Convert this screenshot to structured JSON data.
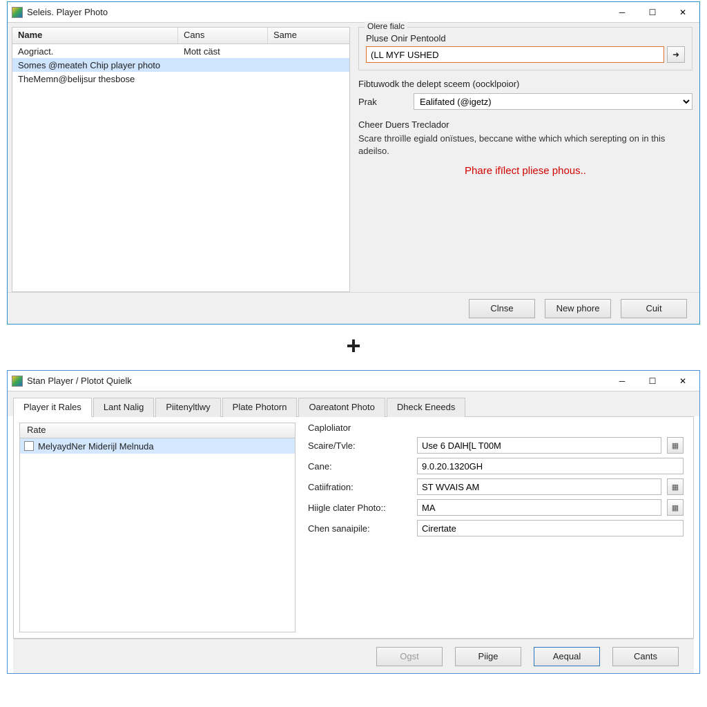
{
  "window1": {
    "title": "Seleis. Player Photo",
    "columns": {
      "c0": "Name",
      "c1": "Cans",
      "c2": "Same"
    },
    "rows": [
      {
        "name": "Aogriact.",
        "cans": "Mott cäst",
        "same": ""
      },
      {
        "name": "Somes @meateh Chip player photo",
        "cans": "",
        "same": ""
      },
      {
        "name": "TheMemn@belijsur thesbose",
        "cans": "",
        "same": ""
      }
    ],
    "selectedRow": 1,
    "group_legend": "Olere fialc",
    "field1_label": "Pluse Onir Pentoold",
    "field1_value": "(LL MYF USHED",
    "section2_title": "Fibtuwodk the delept sceem (oocklpoior)",
    "prak_label": "Prak",
    "prak_value": "Ealifated (@igetz)",
    "section3_title": "Cheer Duers Treclador",
    "desc": "Scare throïlle egiald onïstues, beccane withe which which serepting on in this adeilso.",
    "warn": "Phare ifïlect pliese phous..",
    "buttons": {
      "close": "Clnse",
      "new": "New phore",
      "cuit": "Cuit"
    }
  },
  "plus": "+",
  "window2": {
    "title": "Stan Player / Plotot Quielk",
    "tabs": [
      "Player it Rales",
      "Lant Nalig",
      "Piitenyltlwy",
      "Plate Photorn",
      "Oareatont Photo",
      "Dheck Eneeds"
    ],
    "activeTab": 0,
    "rate_header": "Rate",
    "rate_item": "MelyaydNer Miderijl Melnuda",
    "cap_legend": "Caploliator",
    "fields": {
      "scare_label": "Scaire/Tvle:",
      "scare_value": "Use 6 DAlH[L T00M",
      "cane_label": "Cane:",
      "cane_value": "9.0.20.1320GH",
      "cat_label": "Catiifration:",
      "cat_value": "ST WVAIS AM",
      "hig_label": "Hiigle clater Photo::",
      "hig_value": "MA",
      "chen_label": "Chen sanaipile:",
      "chen_value": "Cirertate"
    },
    "buttons": {
      "ogst": "Ogst",
      "pige": "Piige",
      "aequal": "Aequal",
      "cants": "Cants"
    }
  }
}
